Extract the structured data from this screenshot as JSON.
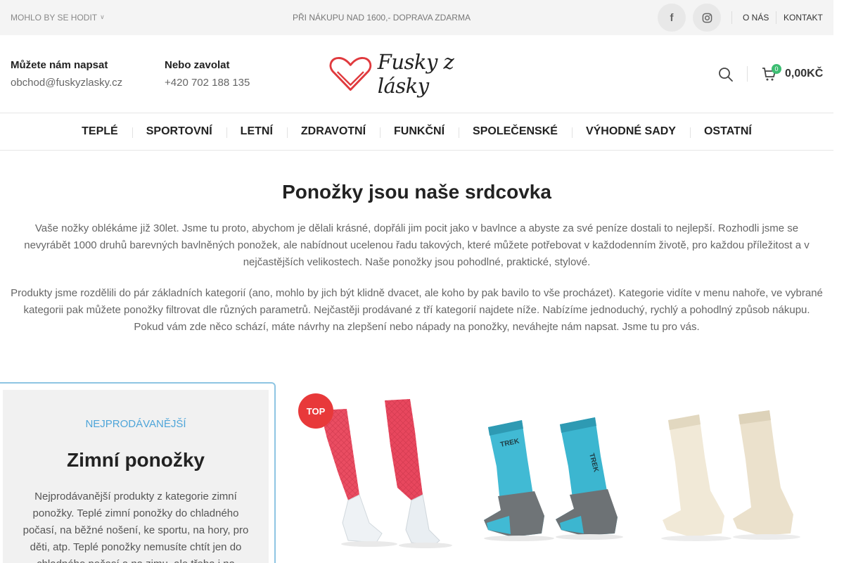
{
  "topbar": {
    "dropdown_label": "MOHLO BY SE HODIT",
    "promo": "PŘI NÁKUPU NAD 1600,- DOPRAVA ZDARMA",
    "social": [
      {
        "label": "f",
        "icon": "facebook-icon"
      },
      {
        "label": "◎",
        "icon": "instagram-icon"
      }
    ],
    "links": [
      "O NÁS",
      "KONTAKT"
    ]
  },
  "header": {
    "contacts": [
      {
        "title": "Můžete nám napsat",
        "value": "obchod@fuskyzlasky.cz"
      },
      {
        "title": "Nebo zavolat",
        "value": "+420 702 188 135"
      }
    ],
    "logo_text": "Fusky z lásky",
    "cart": {
      "count": "0",
      "amount": "0,00KČ"
    }
  },
  "nav": {
    "items": [
      "TEPLÉ",
      "SPORTOVNÍ",
      "LETNÍ",
      "ZDRAVOTNÍ",
      "FUNKČNÍ",
      "SPOLEČENSKÉ",
      "VÝHODNÉ SADY",
      "OSTATNÍ"
    ]
  },
  "intro": {
    "title": "Ponožky jsou naše srdcovka",
    "p1": "Vaše nožky oblékáme již 30let. Jsme tu proto, abychom je dělali krásné, dopřáli jim pocit jako v bavlnce a abyste za své peníze dostali to nejlepší. Rozhodli jsme se nevyrábět 1000 druhů barevných bavlněných ponožek, ale nabídnout ucelenou řadu takových, které můžete potřebovat v každodenním životě, pro každou příležitost a v nejčastějších velikostech. Naše ponožky jsou pohodlné, praktické, stylové.",
    "p2": "Produkty jsme rozdělili do pár základních kategorií (ano, mohlo by jich být klidně dvacet, ale koho by pak bavilo to vše procházet). Kategorie vidíte v menu nahoře, ve vybrané kategorii pak můžete ponožky filtrovat dle různých parametrů. Nejčastěji prodávané z tří kategorií najdete níže. Nabízíme jednoduchý, rychlý a pohodlný způsob nákupu. Pokud vám zde něco schází, máte návrhy na zlepšení nebo nápady na ponožky, neváhejte nám napsat. Jsme tu pro vás."
  },
  "category": {
    "kicker": "NEJPRODÁVANĚJŠÍ",
    "title": "Zimní ponožky",
    "description": "Nejprodávanější produkty z kategorie zimní ponožky. Teplé zimní ponožky do chladného počasí, na běžné nošení, ke sportu, na hory, pro děti, atp. Teplé ponožky nemusíte chtít jen do chladného počasí a na zimu, ale třeba i na"
  },
  "products": [
    {
      "badge": "TOP",
      "kind": "pink-leg-sleeves",
      "color": "#e8475e"
    },
    {
      "kind": "blue-trek-socks",
      "color": "#3cb6d0",
      "brand_text": "TREK"
    },
    {
      "kind": "cream-wool-socks",
      "color": "#efe6d2"
    }
  ],
  "colors": {
    "accent_blue": "#4ea5d9",
    "badge_red": "#e8393a",
    "cart_green": "#3dbd72",
    "logo_red": "#e03a3e"
  }
}
